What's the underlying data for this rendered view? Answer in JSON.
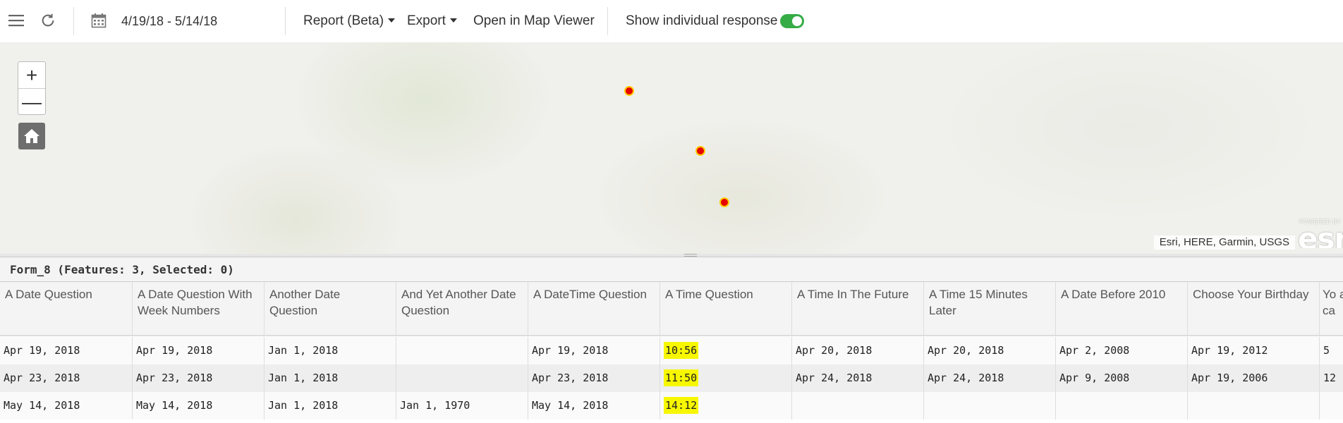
{
  "toolbar": {
    "menu_icon": "hamburger-icon",
    "refresh_icon": "refresh-icon",
    "calendar_icon": "calendar-icon",
    "date_range": "4/19/18 - 5/14/18",
    "report_label": "Report (Beta)",
    "export_label": "Export",
    "open_map_label": "Open in Map Viewer",
    "show_individual_label": "Show individual response",
    "show_individual_on": true,
    "toggle_color": "#35ac46"
  },
  "map": {
    "zoom_in": "+",
    "zoom_out": "—",
    "home_icon": "home-icon",
    "point_color": "#e60000",
    "point_outline": "#ffcc00",
    "point_count": 3,
    "attribution": "Esri, HERE, Garmin, USGS",
    "logo_small": "POWERED BY",
    "logo_big": "esri"
  },
  "table": {
    "title": "Form_8 (Features: 3, Selected: 0)",
    "columns": [
      "A Date Question",
      "A Date Question With Week Numbers",
      "Another Date Question",
      "And Yet Another Date Question",
      "A DateTime Question",
      "A Time Question",
      "A Time In The Future",
      "A Time 15 Minutes Later",
      "A Date Before 2010",
      "Choose Your Birthday",
      "Yo au ca"
    ],
    "rows": [
      [
        "Apr 19, 2018",
        "Apr 19, 2018",
        "Jan 1, 2018",
        "",
        "Apr 19, 2018",
        "10:56",
        "Apr 20, 2018",
        "Apr 20, 2018",
        "Apr 2, 2008",
        "Apr 19, 2012",
        "5"
      ],
      [
        "Apr 23, 2018",
        "Apr 23, 2018",
        "Jan 1, 2018",
        "",
        "Apr 23, 2018",
        "11:50",
        "Apr 24, 2018",
        "Apr 24, 2018",
        "Apr 9, 2008",
        "Apr 19, 2006",
        "12"
      ],
      [
        "May 14, 2018",
        "May 14, 2018",
        "Jan 1, 2018",
        "Jan 1, 1970",
        "May 14, 2018",
        "14:12",
        "",
        "",
        "",
        "",
        ""
      ]
    ],
    "highlight_color": "#f7f700"
  }
}
